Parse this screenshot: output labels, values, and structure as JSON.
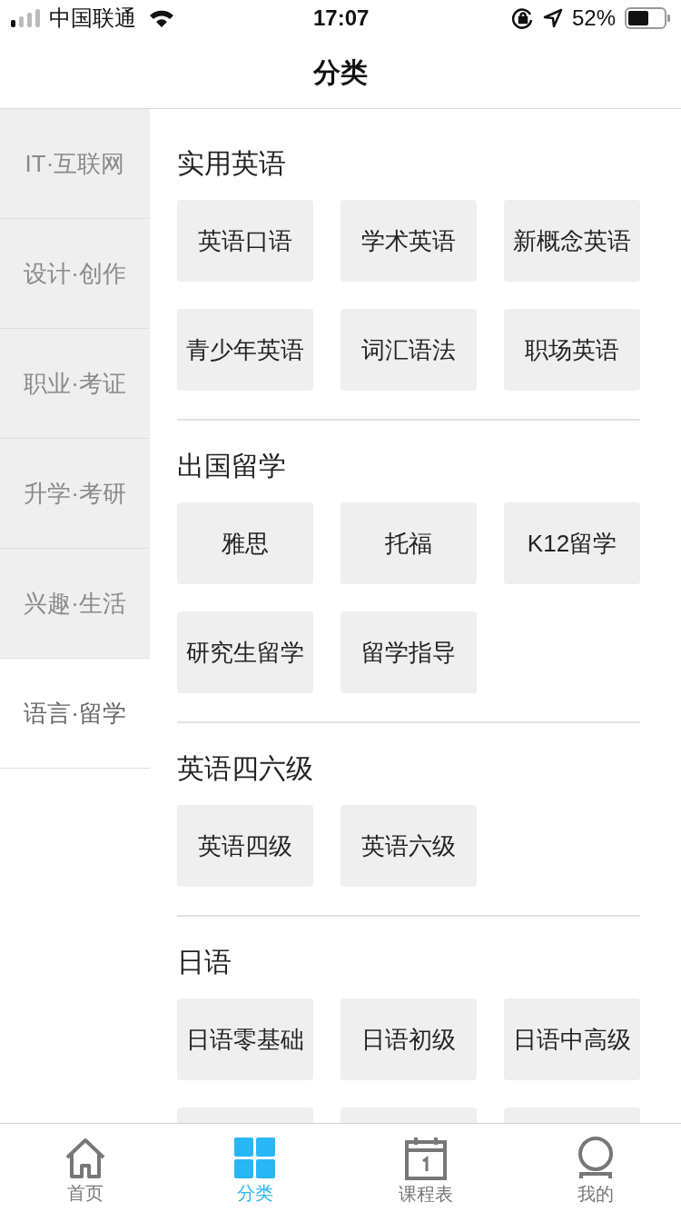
{
  "status_bar": {
    "carrier": "中国联通",
    "time": "17:07",
    "battery": "52%"
  },
  "header": {
    "title": "分类"
  },
  "sidebar": {
    "items": [
      {
        "label": "IT·互联网",
        "selected": false
      },
      {
        "label": "设计·创作",
        "selected": false
      },
      {
        "label": "职业·考证",
        "selected": false
      },
      {
        "label": "升学·考研",
        "selected": false
      },
      {
        "label": "兴趣·生活",
        "selected": false
      },
      {
        "label": "语言·留学",
        "selected": true
      }
    ]
  },
  "sections": [
    {
      "title": "实用英语",
      "chips": [
        {
          "kind": "label",
          "label": "英语口语"
        },
        {
          "kind": "label",
          "label": "学术英语"
        },
        {
          "kind": "label",
          "label": "新概念英语"
        },
        {
          "kind": "label",
          "label": "青少年英语"
        },
        {
          "kind": "label",
          "label": "词汇语法"
        },
        {
          "kind": "label",
          "label": "职场英语"
        }
      ]
    },
    {
      "title": "出国留学",
      "chips": [
        {
          "kind": "label",
          "label": "雅思"
        },
        {
          "kind": "label",
          "label": "托福"
        },
        {
          "kind": "label",
          "label": "K12留学"
        },
        {
          "kind": "label",
          "label": "研究生留学"
        },
        {
          "kind": "label",
          "label": "留学指导"
        }
      ]
    },
    {
      "title": "英语四六级",
      "chips": [
        {
          "kind": "label",
          "label": "英语四级"
        },
        {
          "kind": "label",
          "label": "英语六级"
        }
      ]
    },
    {
      "title": "日语",
      "chips": [
        {
          "kind": "label",
          "label": "日语零基础"
        },
        {
          "kind": "label",
          "label": "日语初级"
        },
        {
          "kind": "label",
          "label": "日语中高级"
        },
        {
          "kind": "cut"
        },
        {
          "kind": "cut"
        },
        {
          "kind": "cut"
        }
      ]
    }
  ],
  "tab_bar": [
    {
      "kind": "home",
      "label": "首页",
      "selected": false
    },
    {
      "kind": "grid",
      "label": "分类",
      "selected": true
    },
    {
      "kind": "calendar",
      "label": "课程表",
      "selected": false
    },
    {
      "kind": "person",
      "label": "我的",
      "selected": false
    }
  ]
}
